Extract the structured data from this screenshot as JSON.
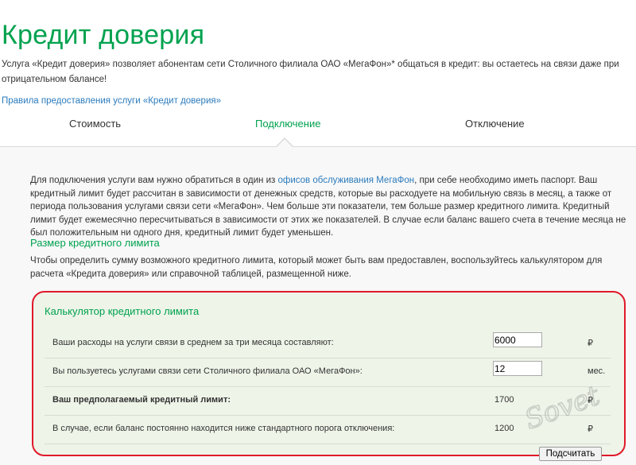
{
  "page": {
    "title": "Кредит доверия",
    "intro": "Услуга «Кредит доверия» позволяет абонентам сети Столичного филиала ОАО «МегаФон»* общаться в кредит: вы остаетесь на связи даже при отрицательном балансе!",
    "rules_link": "Правила предоставления услуги «Кредит доверия»"
  },
  "tabs": [
    {
      "label": "Стоимость"
    },
    {
      "label": "Подключение"
    },
    {
      "label": "Отключение"
    }
  ],
  "active_tab": "Подключение",
  "connection": {
    "text_before_link": "Для подключения услуги вам нужно обратиться в один из ",
    "offices_link": "офисов обслуживания МегаФон",
    "text_after_link": ", при себе необходимо иметь паспорт. Ваш кредитный лимит будет рассчитан в зависимости от денежных средств, которые вы расходуете на мобильную связь в месяц, а также от периода пользования услугами связи сети «МегаФон». Чем больше эти показатели, тем больше размер кредитного лимита. Кредитный лимит будет ежемесячно пересчитываться в зависимости от этих же показателей. В случае если баланс вашего счета в течение месяца не был положительным ни одного дня, кредитный лимит будет уменьшен.",
    "limit_heading": "Размер кредитного лимита",
    "limit_text": "Чтобы определить сумму возможного кредитного лимита, который может быть вам предоставлен, воспользуйтесь калькулятором для расчета «Кредита доверия» или справочной таблицей, размещенной ниже."
  },
  "calculator": {
    "title": "Калькулятор кредитного лимита",
    "rows": [
      {
        "label": "Ваши расходы на услуги связи в среднем за три месяца составляют:",
        "value": "6000",
        "unit": "₽"
      },
      {
        "label": "Вы пользуетесь услугами связи сети Столичного филиала ОАО «МегаФон»:",
        "value": "12",
        "unit": "мес."
      },
      {
        "label": "Ваш предполагаемый кредитный лимит:",
        "value": "1700",
        "unit": "₽"
      },
      {
        "label": "В случае, если баланс постоянно находится ниже стандартного порога отключения:",
        "value": "1200",
        "unit": "₽"
      }
    ],
    "button": "Подсчитать"
  },
  "watermark": "Sovet",
  "colors": {
    "brand_green": "#00a24f",
    "link_blue": "#2b7bbd",
    "highlight_red": "#e0192a",
    "calc_bg": "#eef4e8"
  }
}
